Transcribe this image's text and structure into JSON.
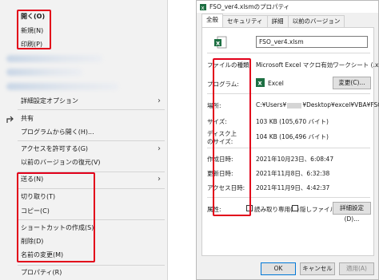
{
  "context_menu": {
    "items_top": [
      "開く(O)",
      "新規(N)",
      "印刷(P)"
    ],
    "advanced_options": "詳細設定オプション",
    "share": "共有",
    "open_with": "プログラムから開く(H)...",
    "grant_access": "アクセスを許可する(G)",
    "restore_previous": "以前のバージョンの復元(V)",
    "send_to": "送る(N)",
    "cut": "切り取り(T)",
    "copy": "コピー(C)",
    "create_shortcut": "ショートカットの作成(S)",
    "delete": "削除(D)",
    "rename": "名前の変更(M)",
    "properties": "プロパティ(R)"
  },
  "dialog": {
    "title": "FSO_ver4.xlsmのプロパティ",
    "tabs": [
      "全般",
      "セキュリティ",
      "詳細",
      "以前のバージョン"
    ],
    "file_name": "FSO_ver4.xlsm",
    "labels": {
      "file_type": "ファイルの種類:",
      "program": "プログラム:",
      "location": "場所:",
      "size": "サイズ:",
      "size_on_disk_1": "ディスク上",
      "size_on_disk_2": "のサイズ:",
      "created": "作成日時:",
      "modified": "更新日時:",
      "accessed": "アクセス日時:",
      "attributes": "属性:"
    },
    "values": {
      "file_type": "Microsoft Excel マクロ有効ワークシート (.xlsm)",
      "program": "Excel",
      "location_prefix": "C:¥Users¥",
      "location_suffix": "¥Desktop¥excel¥VBA¥FSO",
      "size": "103 KB (105,670 バイト)",
      "size_on_disk": "104 KB (106,496 バイト)",
      "created": "2021年10月23日、6:08:47",
      "modified": "2021年11月8日、6:32:38",
      "accessed": "2021年11月9日、4:42:37"
    },
    "change_button": "変更(C)...",
    "readonly_label": "読み取り専用(R)",
    "hidden_label": "隠しファイル(H)",
    "advanced_button": "詳細設定(D)...",
    "ok": "OK",
    "cancel": "キャンセル",
    "apply": "適用(A)"
  },
  "colors": {
    "highlight": "#e2001a",
    "excel_green": "#1d6f42",
    "accent": "#0078d7"
  }
}
